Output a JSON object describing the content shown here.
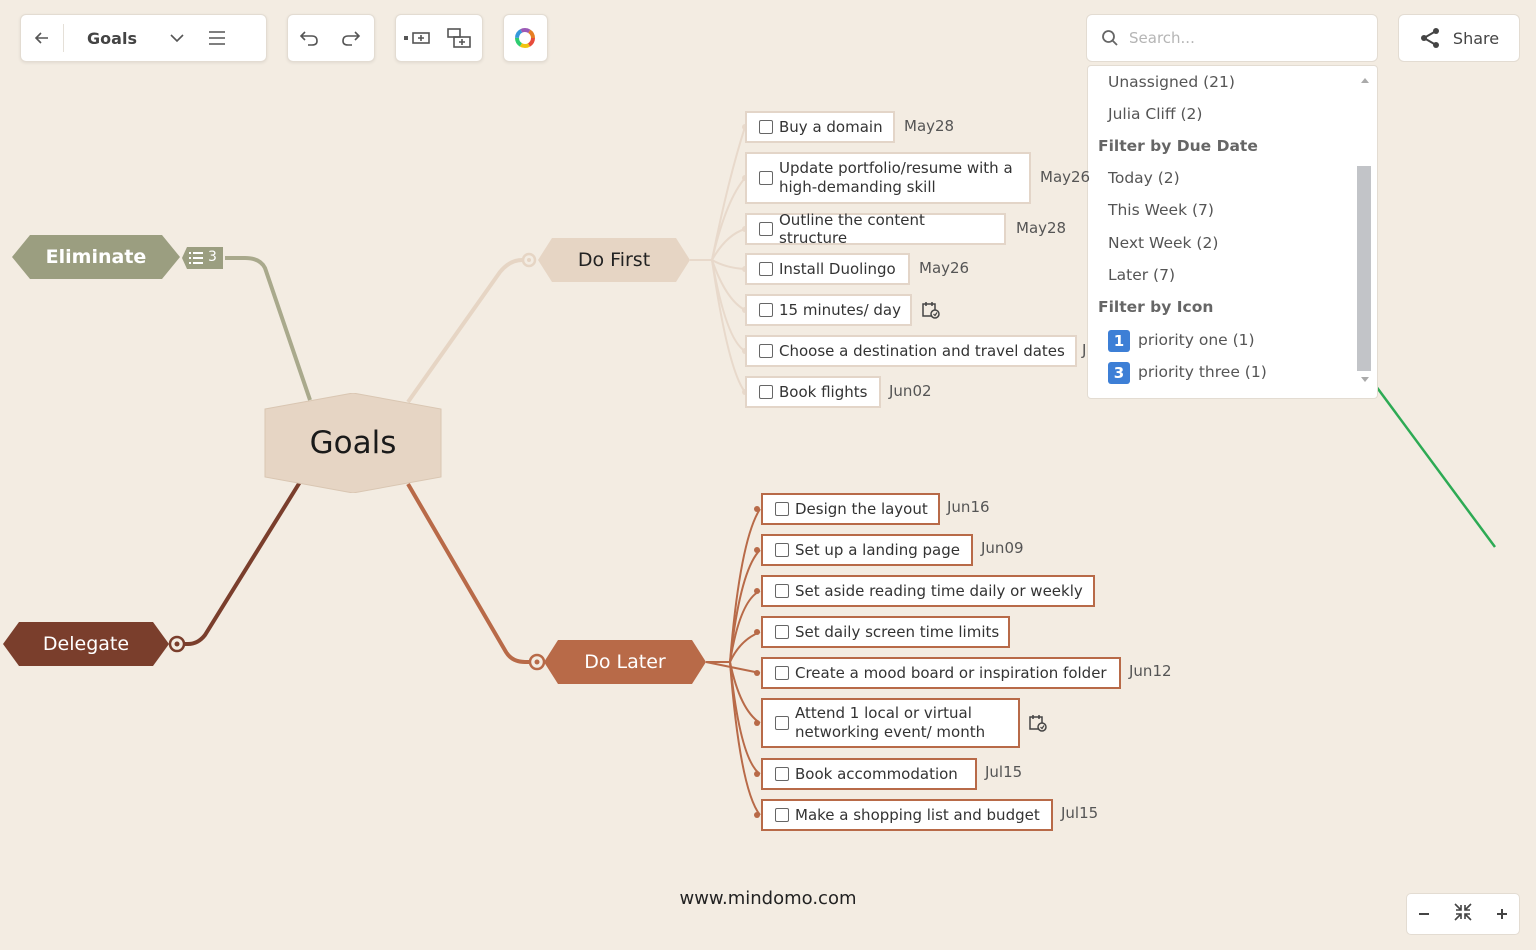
{
  "toolbar": {
    "map_title": "Goals"
  },
  "search": {
    "placeholder": "Search..."
  },
  "share": {
    "label": "Share"
  },
  "filter_dropdown": {
    "assignee_items": [
      "Unassigned (21)",
      "Julia Cliff (2)"
    ],
    "due_date_heading": "Filter by Due Date",
    "due_date_items": [
      "Today (2)",
      "This Week (7)",
      "Next Week (2)",
      "Later (7)"
    ],
    "icon_heading": "Filter by Icon",
    "icon_items": [
      {
        "badge": "1",
        "label": "priority one (1)"
      },
      {
        "badge": "3",
        "label": "priority three (1)"
      }
    ]
  },
  "map": {
    "central": "Goals",
    "eliminate": {
      "label": "Eliminate",
      "task_count": "3"
    },
    "delegate": {
      "label": "Delegate"
    },
    "do_first": {
      "label": "Do First",
      "tasks": [
        {
          "text": "Buy a domain",
          "due": "May28"
        },
        {
          "text": "Update portfolio/resume with a",
          "text2": "high-demanding skill",
          "due": "May26"
        },
        {
          "text": "Outline the content structure",
          "due": "May28"
        },
        {
          "text": "Install Duolingo",
          "due": "May26"
        },
        {
          "text": "15 minutes/ day",
          "due": ""
        },
        {
          "text": "Choose a destination and travel dates",
          "due": "J"
        },
        {
          "text": "Book flights",
          "due": "Jun02"
        }
      ]
    },
    "do_later": {
      "label": "Do Later",
      "tasks": [
        {
          "text": "Design the layout",
          "due": "Jun16"
        },
        {
          "text": "Set up a landing page",
          "due": "Jun09"
        },
        {
          "text": "Set aside reading time daily or weekly",
          "due": ""
        },
        {
          "text": "Set daily screen time limits",
          "due": ""
        },
        {
          "text": "Create a mood board or inspiration folder",
          "due": "Jun12"
        },
        {
          "text": "Attend 1 local or virtual",
          "text2": "networking event/ month",
          "due": ""
        },
        {
          "text": "Book accommodation",
          "due": "Jul15"
        },
        {
          "text": "Make a shopping list and budget",
          "due": "Jul15"
        }
      ]
    }
  },
  "footer": "www.mindomo.com",
  "colors": {
    "background": "#f3ece2",
    "eliminate": "#9b9e80",
    "delegate": "#7a3e2c",
    "do_first": "#e6d5c4",
    "do_later": "#b86a48",
    "arrow": "#2daa54"
  }
}
